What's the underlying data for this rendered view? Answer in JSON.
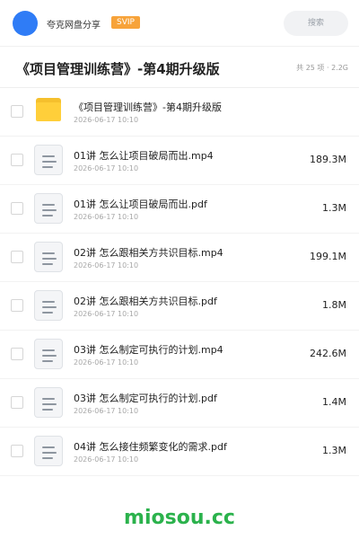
{
  "header": {
    "share_name": "夸克网盘分享",
    "badge": "SVIP",
    "search_placeholder": "搜索"
  },
  "title_bar": {
    "title": "《项目管理训练营》-第4期升级版",
    "meta": "共 25 项 · 2.2G"
  },
  "files": [
    {
      "name": "《项目管理训练营》-第4期升级版",
      "date": "2026-06-17 10:10",
      "size": "",
      "type": "folder"
    },
    {
      "name": "01讲 怎么让项目破局而出.mp4",
      "date": "2026-06-17 10:10",
      "size": "189.3M",
      "type": "file"
    },
    {
      "name": "01讲 怎么让项目破局而出.pdf",
      "date": "2026-06-17 10:10",
      "size": "1.3M",
      "type": "file"
    },
    {
      "name": "02讲 怎么跟相关方共识目标.mp4",
      "date": "2026-06-17 10:10",
      "size": "199.1M",
      "type": "file"
    },
    {
      "name": "02讲 怎么跟相关方共识目标.pdf",
      "date": "2026-06-17 10:10",
      "size": "1.8M",
      "type": "file"
    },
    {
      "name": "03讲 怎么制定可执行的计划.mp4",
      "date": "2026-06-17 10:10",
      "size": "242.6M",
      "type": "file"
    },
    {
      "name": "03讲 怎么制定可执行的计划.pdf",
      "date": "2026-06-17 10:10",
      "size": "1.4M",
      "type": "file"
    },
    {
      "name": "04讲 怎么接住频繁变化的需求.pdf",
      "date": "2026-06-17 10:10",
      "size": "1.3M",
      "type": "file"
    }
  ],
  "footer": {
    "brand": "miosou.cc"
  },
  "colors": {
    "avatar": "#2f7cf6",
    "badge": "#f7a33a",
    "folder": "#ffcf3a",
    "brand": "#2bb24c"
  }
}
